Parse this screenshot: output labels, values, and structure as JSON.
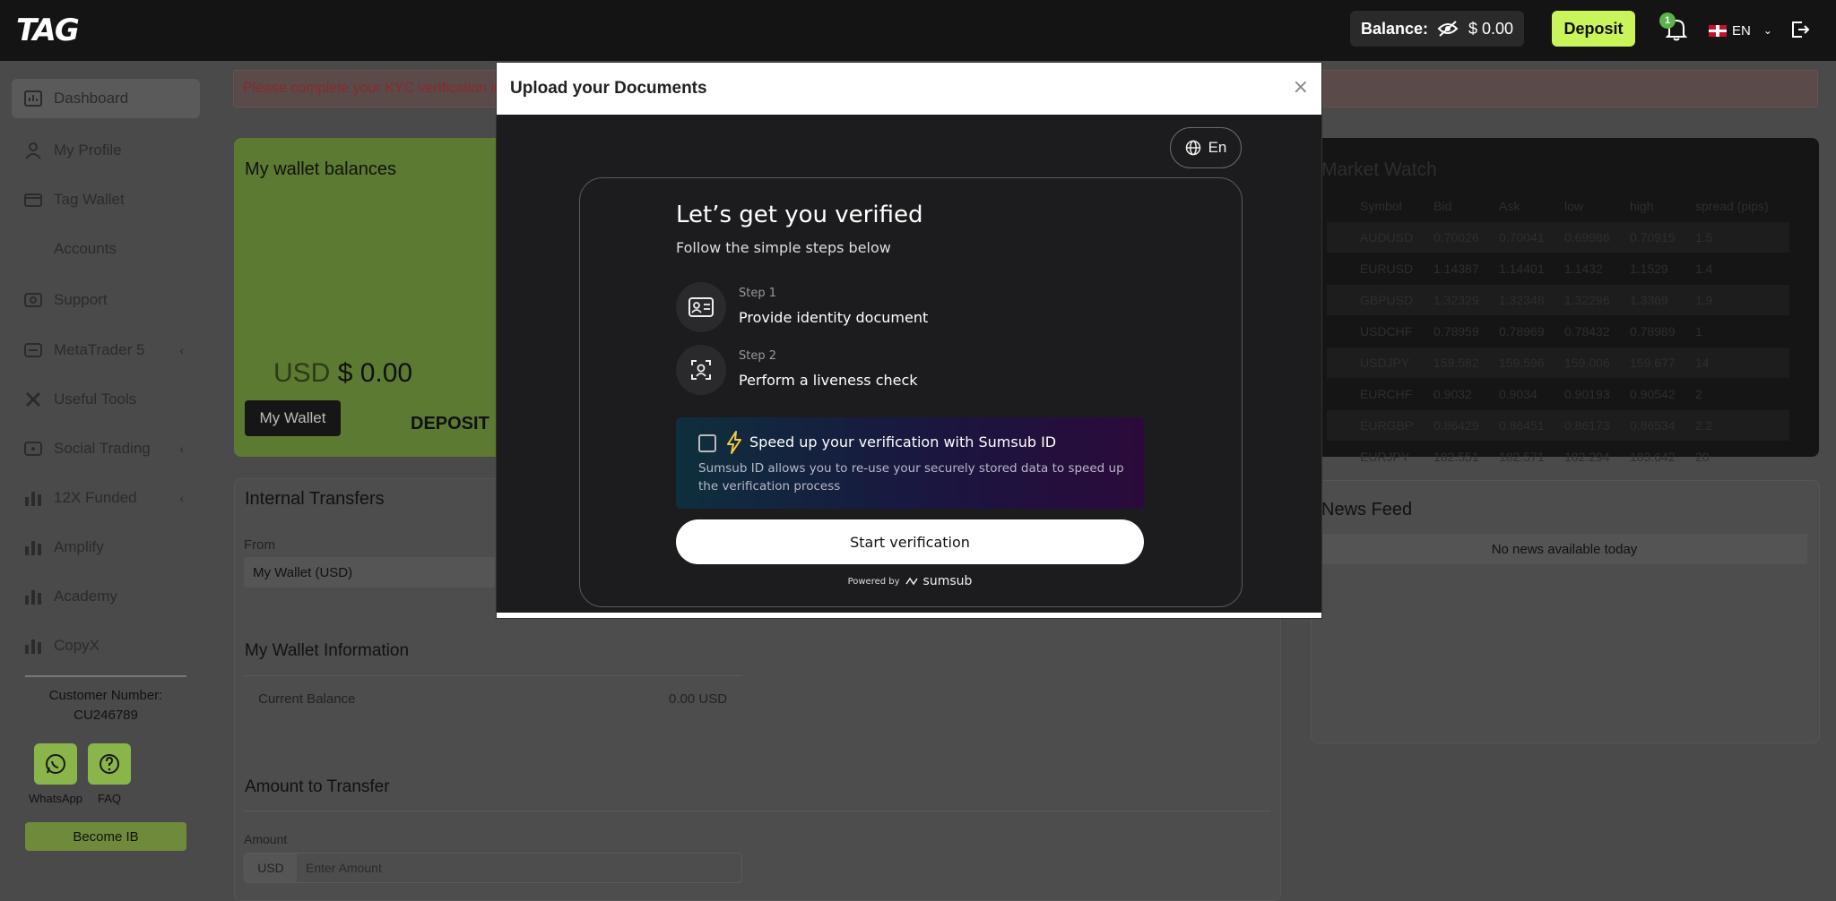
{
  "topbar": {
    "logo": "TAG",
    "balance_label": "Balance:",
    "balance_value": "$ 0.00",
    "deposit_label": "Deposit",
    "notification_count": "1",
    "language": "EN"
  },
  "sidebar": {
    "items": [
      {
        "label": "Dashboard",
        "icon": "dashboard-icon"
      },
      {
        "label": "My Profile",
        "icon": "user-icon"
      },
      {
        "label": "Tag Wallet",
        "icon": "wallet-icon"
      },
      {
        "label": "Accounts",
        "icon": ""
      },
      {
        "label": "Support",
        "icon": "support-icon"
      },
      {
        "label": "MetaTrader 5",
        "icon": "metatrader-icon"
      },
      {
        "label": "Useful Tools",
        "icon": "tools-icon"
      },
      {
        "label": "Social Trading",
        "icon": "social-icon"
      },
      {
        "label": "12X Funded",
        "icon": "chart-icon"
      },
      {
        "label": "Amplify",
        "icon": "chart-icon"
      },
      {
        "label": "Academy",
        "icon": "chart-icon"
      },
      {
        "label": "CopyX",
        "icon": "chart-icon"
      }
    ],
    "customer_label": "Customer Number:",
    "customer_number": "CU246789",
    "whatsapp_label": "WhatsApp",
    "faq_label": "FAQ",
    "become_ib": "Become IB"
  },
  "main": {
    "kyc_alert": "Please complete your KYC verification in",
    "wallet_title": "My wallet balances",
    "wallet_currency": "USD",
    "wallet_amount": "$ 0.00",
    "my_wallet_btn": "My Wallet",
    "deposit_link": "DEPOSIT",
    "internal_transfers": "Internal Transfers",
    "from_label": "From",
    "from_value": "My Wallet (USD)",
    "wallet_info_title": "My Wallet Information",
    "current_balance_label": "Current Balance",
    "current_balance_value": "0.00 USD",
    "amount_to_transfer": "Amount to Transfer",
    "amount_label": "Amount",
    "amount_addon": "USD",
    "amount_placeholder": "Enter Amount"
  },
  "market_watch": {
    "title": "Market Watch",
    "headers": [
      "Symbol",
      "Bid",
      "Ask",
      "low",
      "high",
      "spread (pips)"
    ],
    "rows": [
      [
        "AUDUSD",
        "0.70026",
        "0.70041",
        "0.69986",
        "0.70915",
        "1.5"
      ],
      [
        "EURUSD",
        "1.14387",
        "1.14401",
        "1.1432",
        "1.1529",
        "1.4"
      ],
      [
        "GBPUSD",
        "1.32329",
        "1.32348",
        "1.32296",
        "1.3369",
        "1.9"
      ],
      [
        "USDCHF",
        "0.78959",
        "0.78969",
        "0.78432",
        "0.78989",
        "1"
      ],
      [
        "USDJPY",
        "159.582",
        "159.596",
        "159.006",
        "159.677",
        "14"
      ],
      [
        "EURCHF",
        "0.9032",
        "0.9034",
        "0.90193",
        "0.90542",
        "2"
      ],
      [
        "EURGBP",
        "0.86429",
        "0.86451",
        "0.86173",
        "0.86534",
        "2.2"
      ],
      [
        "EURJPY",
        "182.551",
        "182.571",
        "182.294",
        "183.642",
        "20"
      ]
    ]
  },
  "news_feed": {
    "title": "News Feed",
    "empty": "No news available today"
  },
  "modal": {
    "title": "Upload your Documents",
    "close": "×",
    "language": "En",
    "heading": "Let’s get you verified",
    "subheading": "Follow the simple steps below",
    "steps": [
      {
        "num": "Step 1",
        "text": "Provide identity document"
      },
      {
        "num": "Step 2",
        "text": "Perform a liveness check"
      }
    ],
    "speedup_title": "Speed up your verification with Sumsub ID",
    "speedup_desc": "Sumsub ID allows you to re-use your securely stored data to speed up the verification process",
    "start_button": "Start verification",
    "powered_by": "Powered by",
    "brand": "sumsub"
  },
  "colors": {
    "accent": "#c9f45a",
    "topbar": "#141414",
    "overlay": "#4a4a4a",
    "modal_bg": "#1c1c1e"
  }
}
